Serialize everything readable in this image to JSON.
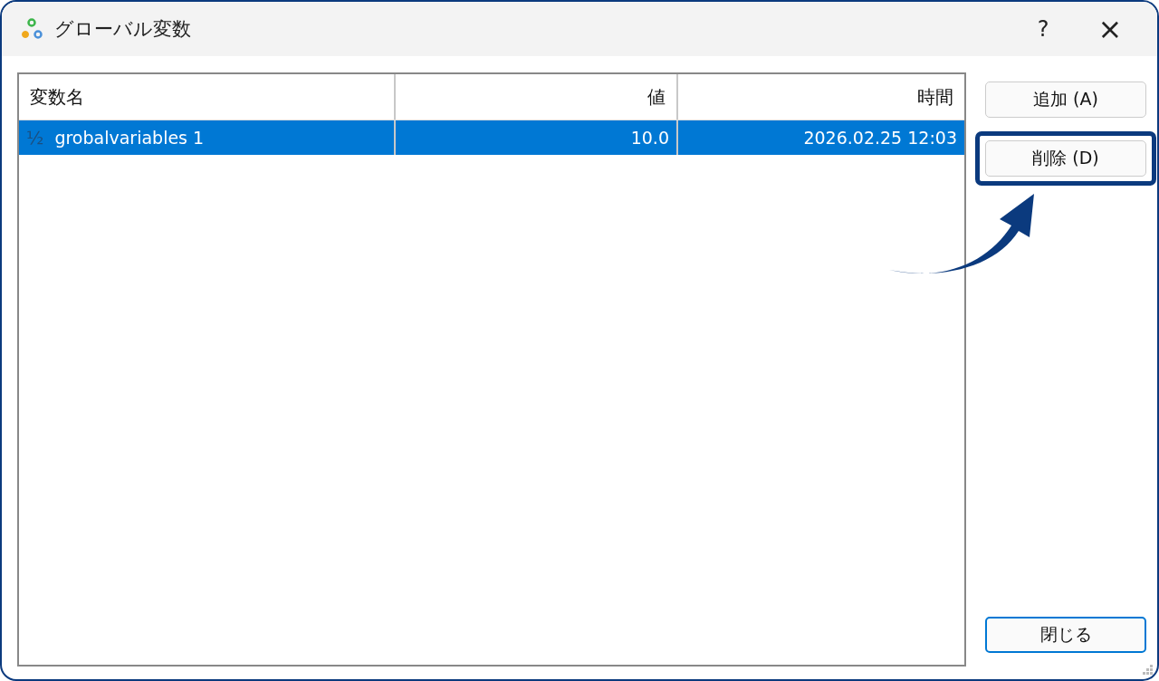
{
  "window": {
    "title": "グローバル変数",
    "help": "?",
    "close": "×"
  },
  "table": {
    "columns": [
      {
        "label": "変数名"
      },
      {
        "label": "値"
      },
      {
        "label": "時間"
      }
    ],
    "rows": [
      {
        "icon": "½",
        "name": "grobalvariables 1",
        "value": "10.0",
        "time": "2026.02.25 12:03",
        "selected": true
      }
    ]
  },
  "buttons": [
    {
      "label": "追加 (A)",
      "highlighted": false,
      "focused": false
    },
    {
      "label": "削除 (D)",
      "highlighted": true,
      "focused": false
    },
    {
      "label": "閉じる",
      "highlighted": false,
      "focused": true
    }
  ]
}
